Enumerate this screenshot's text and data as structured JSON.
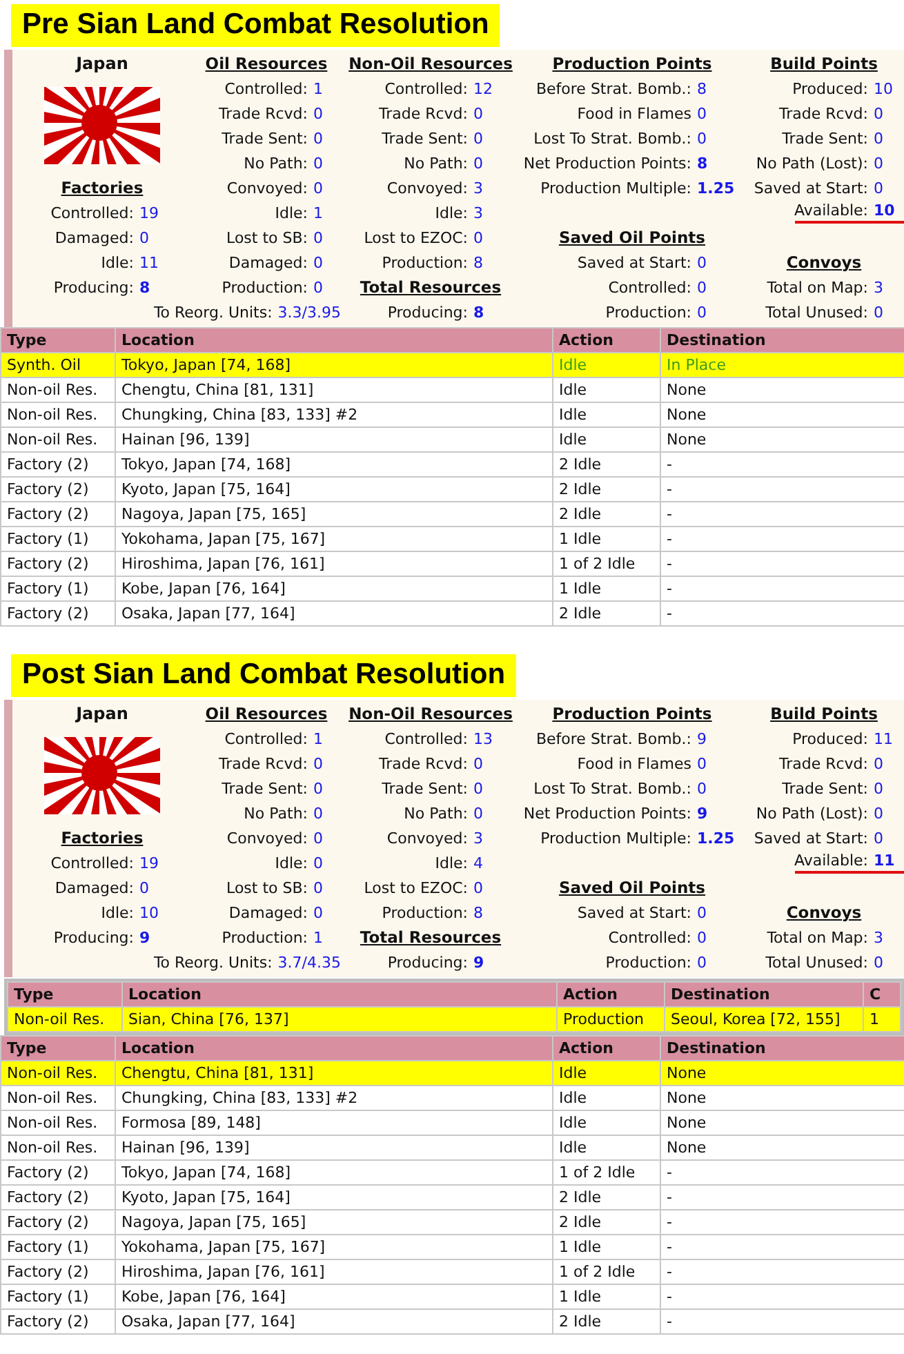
{
  "sections": [
    {
      "title": "Pre Sian Land Combat Resolution",
      "panel": {
        "columns": [
          {
            "lines": [
              {
                "kind": "title",
                "text": "Japan"
              },
              {
                "kind": "flag"
              },
              {
                "kind": "heading",
                "text": "Factories"
              },
              {
                "kind": "stat",
                "label": "Controlled:",
                "value": "19"
              },
              {
                "kind": "stat",
                "label": "Damaged:",
                "value": "0"
              },
              {
                "kind": "stat",
                "label": "Idle:",
                "value": "11"
              },
              {
                "kind": "stat",
                "label": "Producing:",
                "value": "8",
                "strong": true
              }
            ]
          },
          {
            "lines": [
              {
                "kind": "heading",
                "text": "Oil Resources"
              },
              {
                "kind": "stat",
                "label": "Controlled:",
                "value": "1"
              },
              {
                "kind": "stat",
                "label": "Trade Rcvd:",
                "value": "0"
              },
              {
                "kind": "stat",
                "label": "Trade Sent:",
                "value": "0"
              },
              {
                "kind": "stat",
                "label": "No Path:",
                "value": "0"
              },
              {
                "kind": "stat",
                "label": "Convoyed:",
                "value": "0"
              },
              {
                "kind": "stat",
                "label": "Idle:",
                "value": "1"
              },
              {
                "kind": "stat",
                "label": "Lost to SB:",
                "value": "0"
              },
              {
                "kind": "stat",
                "label": "Damaged:",
                "value": "0"
              },
              {
                "kind": "stat",
                "label": "Production:",
                "value": "0"
              },
              {
                "kind": "stat",
                "label": "To Reorg. Units:",
                "value": "3.3/3.95"
              }
            ]
          },
          {
            "lines": [
              {
                "kind": "heading",
                "text": "Non-Oil Resources"
              },
              {
                "kind": "stat",
                "label": "Controlled:",
                "value": "12"
              },
              {
                "kind": "stat",
                "label": "Trade Rcvd:",
                "value": "0"
              },
              {
                "kind": "stat",
                "label": "Trade Sent:",
                "value": "0"
              },
              {
                "kind": "stat",
                "label": "No Path:",
                "value": "0"
              },
              {
                "kind": "stat",
                "label": "Convoyed:",
                "value": "3"
              },
              {
                "kind": "stat",
                "label": "Idle:",
                "value": "3"
              },
              {
                "kind": "stat",
                "label": "Lost to EZOC:",
                "value": "0"
              },
              {
                "kind": "stat",
                "label": "Production:",
                "value": "8"
              },
              {
                "kind": "heading",
                "text": "Total Resources"
              },
              {
                "kind": "stat",
                "label": "Producing:",
                "value": "8",
                "strong": true
              }
            ]
          },
          {
            "lines": [
              {
                "kind": "heading",
                "text": "Production Points"
              },
              {
                "kind": "stat",
                "label": "Before Strat. Bomb.:",
                "value": "8"
              },
              {
                "kind": "stat",
                "label": "Food in Flames",
                "value": "0"
              },
              {
                "kind": "stat",
                "label": "Lost To Strat. Bomb.:",
                "value": "0"
              },
              {
                "kind": "stat",
                "label": "Net Production Points:",
                "value": "8",
                "strong": true
              },
              {
                "kind": "stat",
                "label": "Production Multiple:",
                "value": "1.25",
                "strong": true
              },
              {
                "kind": "gap"
              },
              {
                "kind": "heading",
                "text": "Saved Oil Points"
              },
              {
                "kind": "stat",
                "label": "Saved at Start:",
                "value": "0"
              },
              {
                "kind": "stat",
                "label": "Controlled:",
                "value": "0"
              },
              {
                "kind": "stat",
                "label": "Production:",
                "value": "0"
              }
            ]
          },
          {
            "lines": [
              {
                "kind": "heading",
                "text": "Build Points"
              },
              {
                "kind": "stat",
                "label": "Produced:",
                "value": "10"
              },
              {
                "kind": "stat",
                "label": "Trade Rcvd:",
                "value": "0"
              },
              {
                "kind": "stat",
                "label": "Trade Sent:",
                "value": "0"
              },
              {
                "kind": "stat",
                "label": "No Path (Lost):",
                "value": "0"
              },
              {
                "kind": "stat",
                "label": "Saved at Start:",
                "value": "0"
              },
              {
                "kind": "stat",
                "label": "Available:",
                "value": "10",
                "strong": true,
                "underlined": true
              },
              {
                "kind": "gap"
              },
              {
                "kind": "heading",
                "text": "Convoys"
              },
              {
                "kind": "stat",
                "label": "Total on Map:",
                "value": "3"
              },
              {
                "kind": "stat",
                "label": "Total Unused:",
                "value": "0"
              }
            ]
          }
        ]
      },
      "tables": [
        {
          "columns": [
            "Type",
            "Location",
            "Action",
            "Destination"
          ],
          "rows": [
            {
              "selected": true,
              "ready": true,
              "cells": [
                "Synth. Oil",
                "Tokyo, Japan [74, 168]",
                "Idle",
                "In Place"
              ]
            },
            {
              "selected": false,
              "ready": false,
              "cells": [
                "Non-oil Res.",
                "Chengtu, China [81, 131]",
                "Idle",
                "None"
              ]
            },
            {
              "selected": false,
              "ready": false,
              "cells": [
                "Non-oil Res.",
                "Chungking, China [83, 133] #2",
                "Idle",
                "None"
              ]
            },
            {
              "selected": false,
              "ready": false,
              "cells": [
                "Non-oil Res.",
                "Hainan [96, 139]",
                "Idle",
                "None"
              ]
            },
            {
              "selected": false,
              "ready": false,
              "cells": [
                "Factory (2)",
                "Tokyo, Japan [74, 168]",
                "2 Idle",
                "-"
              ]
            },
            {
              "selected": false,
              "ready": false,
              "cells": [
                "Factory (2)",
                "Kyoto, Japan [75, 164]",
                "2 Idle",
                "-"
              ]
            },
            {
              "selected": false,
              "ready": false,
              "cells": [
                "Factory (2)",
                "Nagoya, Japan [75, 165]",
                "2 Idle",
                "-"
              ]
            },
            {
              "selected": false,
              "ready": false,
              "cells": [
                "Factory (1)",
                "Yokohama, Japan [75, 167]",
                "1 Idle",
                "-"
              ]
            },
            {
              "selected": false,
              "ready": false,
              "cells": [
                "Factory (2)",
                "Hiroshima, Japan [76, 161]",
                "1 of 2 Idle",
                "-"
              ]
            },
            {
              "selected": false,
              "ready": false,
              "cells": [
                "Factory (1)",
                "Kobe, Japan [76, 164]",
                "1 Idle",
                "-"
              ]
            },
            {
              "selected": false,
              "ready": false,
              "cells": [
                "Factory (2)",
                "Osaka, Japan [77, 164]",
                "2 Idle",
                "-"
              ]
            }
          ]
        }
      ]
    },
    {
      "title": "Post Sian Land Combat Resolution",
      "panel": {
        "columns": [
          {
            "lines": [
              {
                "kind": "title",
                "text": "Japan"
              },
              {
                "kind": "flag"
              },
              {
                "kind": "heading",
                "text": "Factories"
              },
              {
                "kind": "stat",
                "label": "Controlled:",
                "value": "19"
              },
              {
                "kind": "stat",
                "label": "Damaged:",
                "value": "0"
              },
              {
                "kind": "stat",
                "label": "Idle:",
                "value": "10"
              },
              {
                "kind": "stat",
                "label": "Producing:",
                "value": "9",
                "strong": true
              }
            ]
          },
          {
            "lines": [
              {
                "kind": "heading",
                "text": "Oil Resources"
              },
              {
                "kind": "stat",
                "label": "Controlled:",
                "value": "1"
              },
              {
                "kind": "stat",
                "label": "Trade Rcvd:",
                "value": "0"
              },
              {
                "kind": "stat",
                "label": "Trade Sent:",
                "value": "0"
              },
              {
                "kind": "stat",
                "label": "No Path:",
                "value": "0"
              },
              {
                "kind": "stat",
                "label": "Convoyed:",
                "value": "0"
              },
              {
                "kind": "stat",
                "label": "Idle:",
                "value": "0"
              },
              {
                "kind": "stat",
                "label": "Lost to SB:",
                "value": "0"
              },
              {
                "kind": "stat",
                "label": "Damaged:",
                "value": "0"
              },
              {
                "kind": "stat",
                "label": "Production:",
                "value": "1"
              },
              {
                "kind": "stat",
                "label": "To Reorg. Units:",
                "value": "3.7/4.35"
              }
            ]
          },
          {
            "lines": [
              {
                "kind": "heading",
                "text": "Non-Oil Resources"
              },
              {
                "kind": "stat",
                "label": "Controlled:",
                "value": "13"
              },
              {
                "kind": "stat",
                "label": "Trade Rcvd:",
                "value": "0"
              },
              {
                "kind": "stat",
                "label": "Trade Sent:",
                "value": "0"
              },
              {
                "kind": "stat",
                "label": "No Path:",
                "value": "0"
              },
              {
                "kind": "stat",
                "label": "Convoyed:",
                "value": "3"
              },
              {
                "kind": "stat",
                "label": "Idle:",
                "value": "4"
              },
              {
                "kind": "stat",
                "label": "Lost to EZOC:",
                "value": "0"
              },
              {
                "kind": "stat",
                "label": "Production:",
                "value": "8"
              },
              {
                "kind": "heading",
                "text": "Total Resources"
              },
              {
                "kind": "stat",
                "label": "Producing:",
                "value": "9",
                "strong": true
              }
            ]
          },
          {
            "lines": [
              {
                "kind": "heading",
                "text": "Production Points"
              },
              {
                "kind": "stat",
                "label": "Before Strat. Bomb.:",
                "value": "9"
              },
              {
                "kind": "stat",
                "label": "Food in Flames",
                "value": "0"
              },
              {
                "kind": "stat",
                "label": "Lost To Strat. Bomb.:",
                "value": "0"
              },
              {
                "kind": "stat",
                "label": "Net Production Points:",
                "value": "9",
                "strong": true
              },
              {
                "kind": "stat",
                "label": "Production Multiple:",
                "value": "1.25",
                "strong": true
              },
              {
                "kind": "gap"
              },
              {
                "kind": "heading",
                "text": "Saved Oil Points"
              },
              {
                "kind": "stat",
                "label": "Saved at Start:",
                "value": "0"
              },
              {
                "kind": "stat",
                "label": "Controlled:",
                "value": "0"
              },
              {
                "kind": "stat",
                "label": "Production:",
                "value": "0"
              }
            ]
          },
          {
            "lines": [
              {
                "kind": "heading",
                "text": "Build Points"
              },
              {
                "kind": "stat",
                "label": "Produced:",
                "value": "11"
              },
              {
                "kind": "stat",
                "label": "Trade Rcvd:",
                "value": "0"
              },
              {
                "kind": "stat",
                "label": "Trade Sent:",
                "value": "0"
              },
              {
                "kind": "stat",
                "label": "No Path (Lost):",
                "value": "0"
              },
              {
                "kind": "stat",
                "label": "Saved at Start:",
                "value": "0"
              },
              {
                "kind": "stat",
                "label": "Available:",
                "value": "11",
                "strong": true,
                "underlined": true
              },
              {
                "kind": "gap"
              },
              {
                "kind": "heading",
                "text": "Convoys"
              },
              {
                "kind": "stat",
                "label": "Total on Map:",
                "value": "3"
              },
              {
                "kind": "stat",
                "label": "Total Unused:",
                "value": "0"
              }
            ]
          }
        ]
      },
      "tables": [
        {
          "columns": [
            "Type",
            "Location",
            "Action",
            "Destination",
            "C"
          ],
          "rows": [
            {
              "selected": true,
              "ready": false,
              "cells": [
                "Non-oil Res.",
                "Sian, China [76, 137]",
                "Production",
                "Seoul, Korea [72, 155]",
                "1"
              ]
            }
          ]
        },
        {
          "columns": [
            "Type",
            "Location",
            "Action",
            "Destination"
          ],
          "rows": [
            {
              "selected": true,
              "ready": false,
              "cells": [
                "Non-oil Res.",
                "Chengtu, China [81, 131]",
                "Idle",
                "None"
              ]
            },
            {
              "selected": false,
              "ready": false,
              "cells": [
                "Non-oil Res.",
                "Chungking, China [83, 133] #2",
                "Idle",
                "None"
              ]
            },
            {
              "selected": false,
              "ready": false,
              "cells": [
                "Non-oil Res.",
                "Formosa [89, 148]",
                "Idle",
                "None"
              ]
            },
            {
              "selected": false,
              "ready": false,
              "cells": [
                "Non-oil Res.",
                "Hainan [96, 139]",
                "Idle",
                "None"
              ]
            },
            {
              "selected": false,
              "ready": false,
              "cells": [
                "Factory (2)",
                "Tokyo, Japan [74, 168]",
                "1 of 2 Idle",
                "-"
              ]
            },
            {
              "selected": false,
              "ready": false,
              "cells": [
                "Factory (2)",
                "Kyoto, Japan [75, 164]",
                "2 Idle",
                "-"
              ]
            },
            {
              "selected": false,
              "ready": false,
              "cells": [
                "Factory (2)",
                "Nagoya, Japan [75, 165]",
                "2 Idle",
                "-"
              ]
            },
            {
              "selected": false,
              "ready": false,
              "cells": [
                "Factory (1)",
                "Yokohama, Japan [75, 167]",
                "1 Idle",
                "-"
              ]
            },
            {
              "selected": false,
              "ready": false,
              "cells": [
                "Factory (2)",
                "Hiroshima, Japan [76, 161]",
                "1 of 2 Idle",
                "-"
              ]
            },
            {
              "selected": false,
              "ready": false,
              "cells": [
                "Factory (1)",
                "Kobe, Japan [76, 164]",
                "1 Idle",
                "-"
              ]
            },
            {
              "selected": false,
              "ready": false,
              "cells": [
                "Factory (2)",
                "Osaka, Japan [77, 164]",
                "2 Idle",
                "-"
              ]
            }
          ]
        }
      ]
    }
  ]
}
